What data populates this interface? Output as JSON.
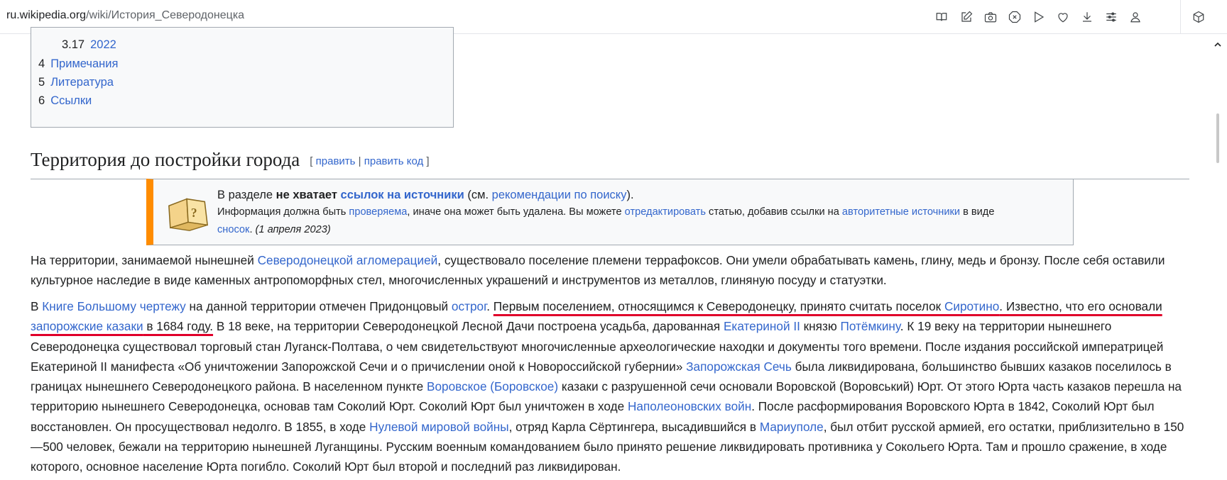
{
  "browser": {
    "url_host": "ru.wikipedia.org",
    "url_path": "/wiki/История_Северодонецка",
    "icons": [
      "reader-view-icon",
      "edit-icon",
      "screenshot-icon",
      "block-icon",
      "play-icon",
      "heart-icon",
      "download-icon",
      "sliders-icon",
      "profile-icon",
      "extensions-icon"
    ]
  },
  "toc": {
    "items": [
      {
        "num": "3.17",
        "label": "2022"
      },
      {
        "num": "4",
        "label": "Примечания"
      },
      {
        "num": "5",
        "label": "Литература"
      },
      {
        "num": "6",
        "label": "Ссылки"
      }
    ]
  },
  "section": {
    "title": "Территория до постройки города",
    "edit_open": "[",
    "edit": "править",
    "sep": "|",
    "edit_code": "править код",
    "edit_close": "]"
  },
  "ambox": {
    "l1_a": "В разделе ",
    "l1_b": "не хватает",
    "l1_c": "ссылок на источники",
    "l1_d": " (см. ",
    "l1_e": "рекомендации по поиску",
    "l1_f": ").",
    "l2_a": "Информация должна быть ",
    "l2_b": "проверяема",
    "l2_c": ", иначе она может быть удалена. Вы можете ",
    "l2_d": "отредактировать",
    "l2_e": " статью, добавив ссылки на ",
    "l2_f": "авторитетные источники",
    "l2_g": " в виде",
    "l3_a": "сносок",
    "l3_b": ". ",
    "l3_c": "(1 апреля 2023)"
  },
  "p1": {
    "a": "На территории, занимаемой нынешней ",
    "b": "Северодонецкой агломерацией",
    "c": ", существовало поселение племени террафоксов. Они умели обрабатывать камень, глину, медь и бронзу. После себя оставили культурное наследие в виде каменных антропоморфных стел, многочисленных украшений и инструментов из металлов, глиняную посуду и статуэтки."
  },
  "p2": {
    "a": "В ",
    "b": "Книге Большому чертежу",
    "c": " на данной территории отмечен Придонцовый ",
    "d": "острог",
    "e": ". ",
    "f": "Первым поселением, относящимся к Северодонецку, принято считать поселок ",
    "g": "Сиротино",
    "h": ". Известно, что его основали ",
    "i": "запорожские казаки",
    "j": " в 1684 году.",
    "k": " В 18 веке, на территории Северодонецкой Лесной Дачи построена усадьба, дарованная ",
    "l": "Екатериной II",
    "m": " князю ",
    "n": "Потёмкину",
    "o": ". К 19 веку на территории нынешнего Северодонецка существовал торговый стан Луганск-Полтава, о чем свидетельствуют многочисленные археологические находки и документы того времени. После издания российской императрицей Екатериной II манифеста «Об уничтожении Запорожской Сечи и о причислении оной к Новороссийской губернии» ",
    "p": "Запорожская Сечь",
    "q": " была ликвидирована, большинство бывших казаков поселилось в границах нынешнего Северодонецкого района. В населенном пункте ",
    "r": "Воровское (Боровское)",
    "s": " казаки с разрушенной сечи основали Воровской (Воровський) Юрт. От этого Юрта часть казаков перешла на территорию нынешнего Северодонецка, основав там Соколий Юрт. Соколий Юрт был уничтожен в ходе ",
    "t": "Наполеоновских войн",
    "u": ". После расформирования Воровского Юрта в 1842, Соколий Юрт был восстановлен. Он просуществовал недолго. В 1855, в ходе ",
    "v": "Нулевой мировой войны",
    "w": ", отряд Карла Сёртингера, высадившийся в ",
    "x": "Мариуполе",
    "y": ", был отбит русской армией, его остатки, приблизительно в 150—500 человек, бежали на территорию нынешней Луганщины. Русским военным командованием было принято решение ликвидировать противника у Сокольего Юрта. Там и прошло сражение, в ходе которого, основное население Юрта погибло. Соколий Юрт был второй и последний раз ликвидирован."
  },
  "colors": {
    "link": "#3366cc",
    "ambox_accent": "#ff8c00",
    "annotation": "#e0002a"
  }
}
